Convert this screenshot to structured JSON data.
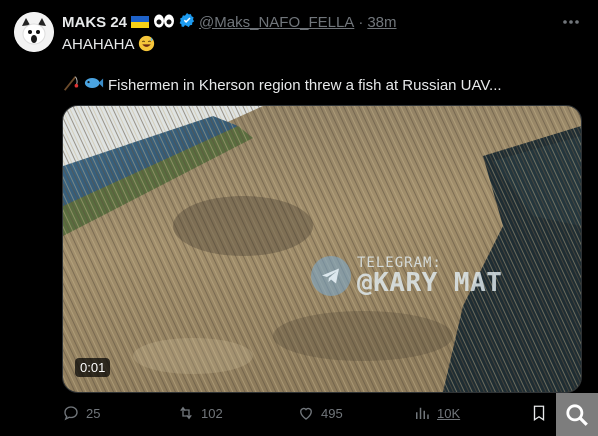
{
  "author": {
    "name": "MAKS 24",
    "handle": "@Maks_NAFO_FELLA",
    "separator": "·",
    "time": "38m",
    "badges": [
      "ukraine-flag",
      "eyes-emoji",
      "verified-badge"
    ]
  },
  "tweet": {
    "line1": "AHAHAHA",
    "line1_emoji": "sweat-smile-emoji",
    "line2": "Fishermen in Kherson region threw a fish at Russian UAV...",
    "line2_emoji": [
      "fishing-pole-emoji",
      "fish-emoji"
    ]
  },
  "media": {
    "duration": "0:01",
    "watermark_line1": "TELEGRAM:",
    "watermark_line2": "@KARY MAT"
  },
  "actions": {
    "replies": "25",
    "retweets": "102",
    "likes": "495",
    "views": "10K"
  },
  "colors": {
    "background": "#000000",
    "text": "#e7e9ea",
    "muted": "#71767b",
    "accent": "#1d9bf0"
  }
}
